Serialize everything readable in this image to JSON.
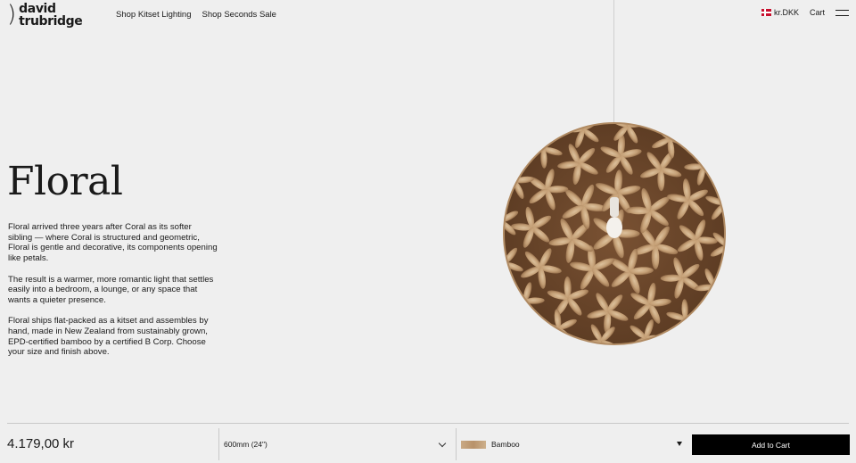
{
  "brand": {
    "logo_line1": "david",
    "logo_line2": "trubridge"
  },
  "nav": {
    "items": [
      "Shop Kitset Lighting",
      "Shop Seconds Sale"
    ]
  },
  "header": {
    "currency": "kr.DKK",
    "cart": "Cart"
  },
  "product": {
    "title": "Floral",
    "paragraphs": [
      "Floral arrived three years after Coral as its softer sibling — where Coral is structured and geometric, Floral is gentle and decorative, its components opening like petals.",
      "The result is a warmer, more romantic light that settles easily into a bedroom, a lounge, or any space that wants a quieter presence.",
      "Floral ships flat-packed as a kitset and assembles by hand, made in New Zealand from sustainably grown, EPD-certified bamboo by a certified B Corp. Choose your size and finish above."
    ]
  },
  "purchase": {
    "price": "4.179,00 kr",
    "size_value": "600mm (24\")",
    "finish_value": "Bamboo",
    "add_to_cart": "Add to Cart"
  },
  "colors": {
    "accent": "#000000",
    "background": "#efefef",
    "bamboo": "#c9a984",
    "flag_red": "#c8102e"
  },
  "icons": [
    "flag-denmark-icon",
    "menu-icon",
    "chevron-down-icon",
    "caret-down-icon"
  ]
}
